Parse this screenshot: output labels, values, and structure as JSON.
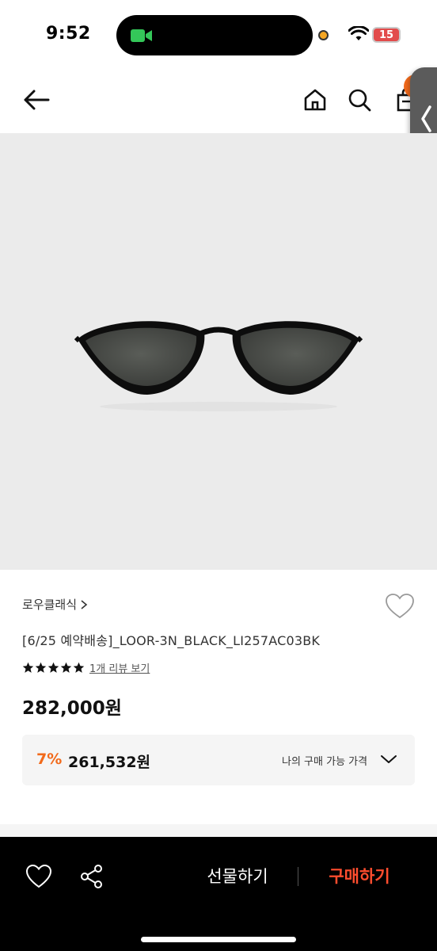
{
  "status_bar": {
    "time": "9:52",
    "battery": "15",
    "icons": [
      "facetime-camera-icon",
      "orange-mic-dot",
      "wifi-icon",
      "battery-icon"
    ]
  },
  "header": {
    "icons": [
      "back-arrow-icon",
      "home-icon",
      "search-icon",
      "shopping-bag-icon",
      "side-panel-chevron-icon"
    ],
    "accent_color": "#f26a1b"
  },
  "product": {
    "image_subject": "black oval sunglasses",
    "brand_link": "로우클래식",
    "title": "[6/25 예약배송]_LOOR-3N_BLACK_LI257AC03BK",
    "rating_stars": 5,
    "review_link": "1개 리뷰 보기",
    "price": "282,000원",
    "member_discount": {
      "rate": "7%",
      "price": "261,532원",
      "label": "나의 구매 가능 가격"
    }
  },
  "bottom_bar": {
    "gift_label": "선물하기",
    "buy_label": "구매하기",
    "buy_color": "#ff4d2e"
  }
}
